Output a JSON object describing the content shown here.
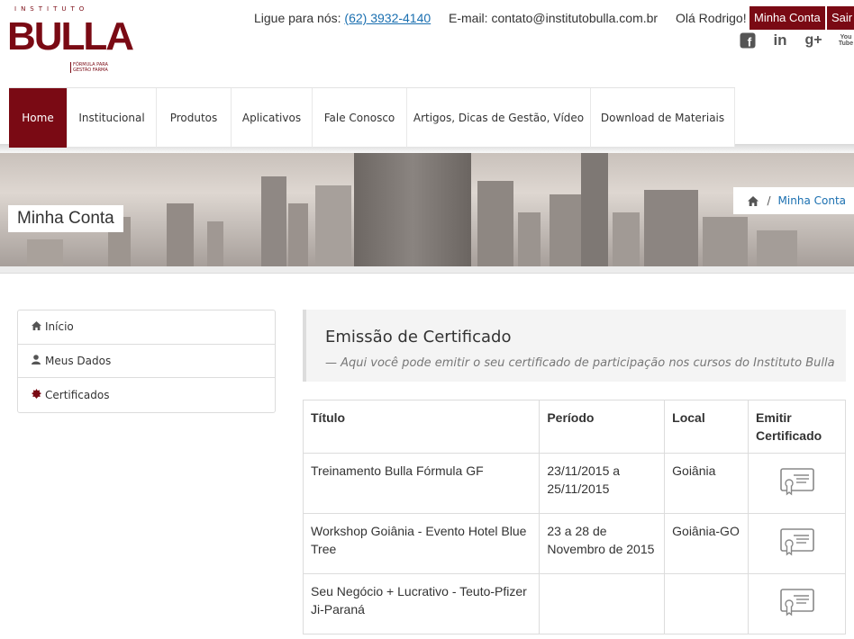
{
  "brand": {
    "top": "INSTITUTO",
    "name": "BULLA",
    "tagline_1": "FÓRMULA PARA",
    "tagline_2": "GESTÃO FARMA"
  },
  "topbar": {
    "phone_label": "Ligue para nós:",
    "phone": "(62) 3932-4140",
    "email": "E-mail: contato@institutobulla.com.br",
    "greeting": "Olá Rodrigo!",
    "account_button": "Minha Conta",
    "logout_button": "Sair"
  },
  "social": {
    "facebook": "f",
    "linkedin": "in",
    "googleplus": "g+",
    "youtube": "You Tube"
  },
  "nav": {
    "items": [
      {
        "label": "Home"
      },
      {
        "label": "Institucional"
      },
      {
        "label": "Produtos"
      },
      {
        "label": "Aplicativos"
      },
      {
        "label": "Fale Conosco"
      },
      {
        "label": "Artigos, Dicas de Gestão, Vídeo"
      },
      {
        "label": "Download de Materiais"
      }
    ]
  },
  "banner": {
    "title": "Minha Conta",
    "breadcrumb_separator": "/",
    "breadcrumb_current": "Minha Conta"
  },
  "sidebar": {
    "items": [
      {
        "label": "Início",
        "icon": "home-icon"
      },
      {
        "label": "Meus Dados",
        "icon": "user-icon"
      },
      {
        "label": "Certificados",
        "icon": "certificate-icon"
      }
    ]
  },
  "main": {
    "title": "Emissão de Certificado",
    "subtitle": "— Aqui você pode emitir o seu certificado de participação nos cursos do Instituto Bulla"
  },
  "table": {
    "headers": [
      "Título",
      "Período",
      "Local",
      "Emitir Certificado"
    ],
    "rows": [
      {
        "titulo": "Treinamento Bulla Fórmula GF",
        "periodo": "23/11/2015 a 25/11/2015",
        "local": "Goiânia"
      },
      {
        "titulo": "Workshop Goiânia - Evento Hotel Blue Tree",
        "periodo": "23 a 28 de Novembro de 2015",
        "local": "Goiânia-GO"
      },
      {
        "titulo": "Seu Negócio + Lucrativo - Teuto-Pfizer Ji-Paraná",
        "periodo": "",
        "local": ""
      }
    ]
  },
  "colors": {
    "brand": "#7a0a14",
    "link": "#1a6fb0"
  }
}
